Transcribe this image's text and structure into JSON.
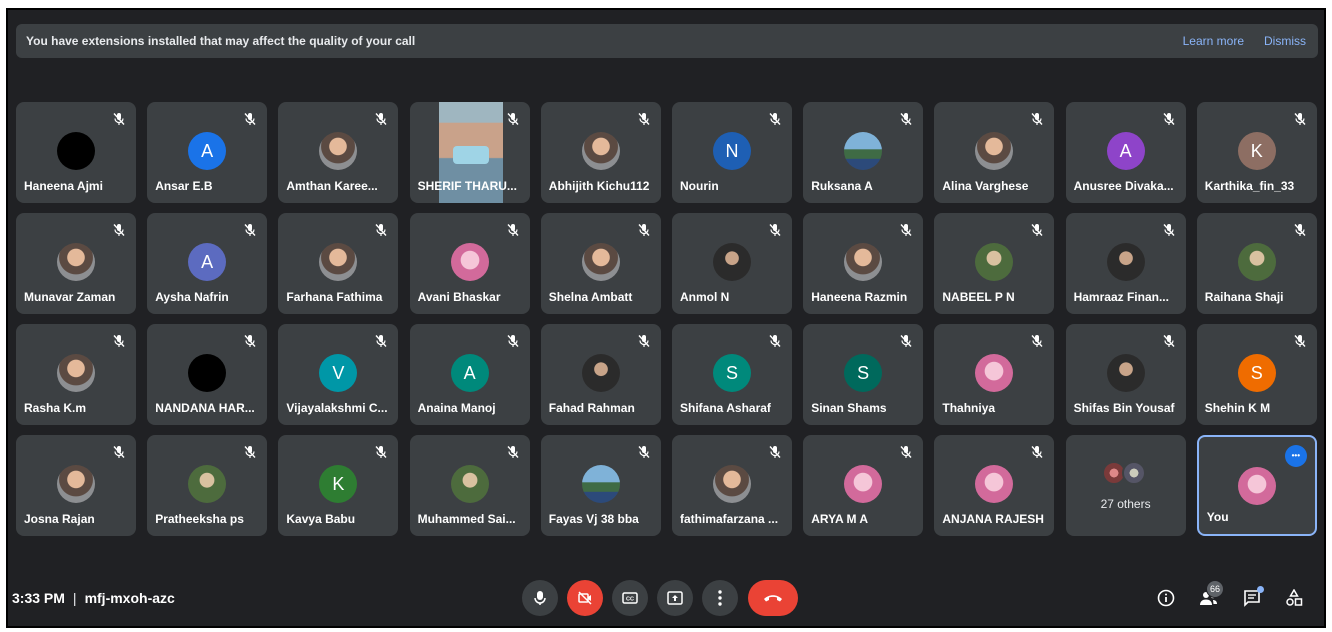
{
  "banner": {
    "message": "You have extensions installed that may affect the quality of your call",
    "learn_more": "Learn more",
    "dismiss": "Dismiss"
  },
  "participants": [
    {
      "name": "Haneena Ajmi",
      "avatar": "photo-black"
    },
    {
      "name": "Ansar E.B",
      "avatar": "initial",
      "initial": "A",
      "color": "#1a73e8"
    },
    {
      "name": "Amthan Karee...",
      "avatar": "photo"
    },
    {
      "name": "SHERIF THARU...",
      "avatar": "video"
    },
    {
      "name": "Abhijith Kichu112",
      "avatar": "photo"
    },
    {
      "name": "Nourin",
      "avatar": "initial",
      "initial": "N",
      "color": "#1e5fb4"
    },
    {
      "name": "Ruksana A",
      "avatar": "photo-sky"
    },
    {
      "name": "Alina Varghese",
      "avatar": "photo"
    },
    {
      "name": "Anusree Divaka...",
      "avatar": "initial",
      "initial": "A",
      "color": "#8e44c9"
    },
    {
      "name": "Karthika_fin_33",
      "avatar": "initial",
      "initial": "K",
      "color": "#8d6e63"
    },
    {
      "name": "Munavar Zaman",
      "avatar": "photo"
    },
    {
      "name": "Aysha Nafrin",
      "avatar": "initial",
      "initial": "A",
      "color": "#5c6bc0"
    },
    {
      "name": "Farhana Fathima",
      "avatar": "photo"
    },
    {
      "name": "Avani Bhaskar",
      "avatar": "photo-pink"
    },
    {
      "name": "Shelna Ambatt",
      "avatar": "photo"
    },
    {
      "name": "Anmol N",
      "avatar": "photo-dark"
    },
    {
      "name": "Haneena Razmin",
      "avatar": "photo"
    },
    {
      "name": "NABEEL P N",
      "avatar": "photo-green"
    },
    {
      "name": "Hamraaz Finan...",
      "avatar": "photo-dark"
    },
    {
      "name": "Raihana Shaji",
      "avatar": "photo-green"
    },
    {
      "name": "Rasha K.m",
      "avatar": "photo"
    },
    {
      "name": "NANDANA HAR...",
      "avatar": "photo-black"
    },
    {
      "name": "Vijayalakshmi C...",
      "avatar": "initial",
      "initial": "V",
      "color": "#0097a7"
    },
    {
      "name": "Anaina Manoj",
      "avatar": "initial",
      "initial": "A",
      "color": "#00897b"
    },
    {
      "name": "Fahad Rahman",
      "avatar": "photo-dark"
    },
    {
      "name": "Shifana Asharaf",
      "avatar": "initial",
      "initial": "S",
      "color": "#00897b"
    },
    {
      "name": "Sinan Shams",
      "avatar": "initial",
      "initial": "S",
      "color": "#00695c"
    },
    {
      "name": "Thahniya",
      "avatar": "photo-pink"
    },
    {
      "name": "Shifas Bin Yousaf",
      "avatar": "photo-dark"
    },
    {
      "name": "Shehin K M",
      "avatar": "initial",
      "initial": "S",
      "color": "#ef6c00"
    },
    {
      "name": "Josna Rajan",
      "avatar": "photo"
    },
    {
      "name": "Pratheeksha ps",
      "avatar": "photo-green"
    },
    {
      "name": "Kavya Babu",
      "avatar": "initial",
      "initial": "K",
      "color": "#2e7d32"
    },
    {
      "name": "Muhammed Sai...",
      "avatar": "photo-green"
    },
    {
      "name": "Fayas Vj 38 bba",
      "avatar": "photo-sky"
    },
    {
      "name": "fathimafarzana ...",
      "avatar": "photo"
    },
    {
      "name": "ARYA M A",
      "avatar": "photo-pink"
    },
    {
      "name": "ANJANA RAJESH",
      "avatar": "photo-pink"
    },
    {
      "name": "",
      "avatar": "others",
      "others_label": "27 others"
    },
    {
      "name": "You",
      "avatar": "photo-pink",
      "self": true
    }
  ],
  "bottom_bar": {
    "time": "3:33 PM",
    "meeting_code": "mfj-mxoh-azc",
    "participants_count": "66",
    "icons": {
      "mic": "microphone-icon",
      "camera_off": "camera-off-icon",
      "captions": "captions-icon",
      "present": "present-screen-icon",
      "more": "more-options-icon",
      "end_call": "end-call-icon",
      "info": "info-icon",
      "people": "people-icon",
      "chat": "chat-icon",
      "activities": "activities-icon"
    }
  },
  "colors": {
    "background": "#202124",
    "tile": "#3c4043",
    "accent": "#8ab4f8",
    "end_call": "#ea4335"
  }
}
